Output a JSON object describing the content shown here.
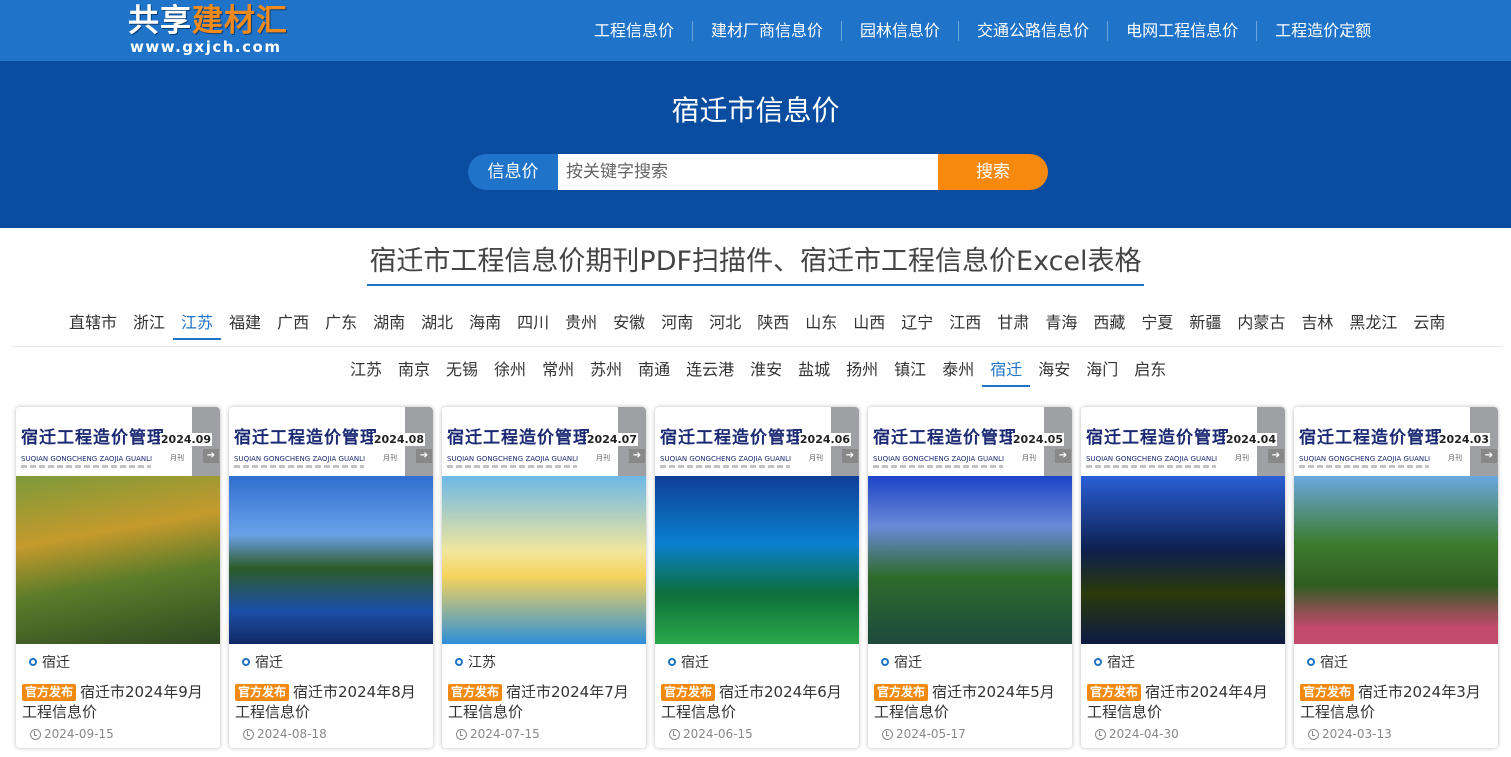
{
  "logo": {
    "title_part1": "共享",
    "title_part2": "建材汇",
    "url": "www.gxjch.com"
  },
  "nav": [
    "工程信息价",
    "建材厂商信息价",
    "园林信息价",
    "交通公路信息价",
    "电网工程信息价",
    "工程造价定额"
  ],
  "hero": {
    "title": "宿迁市信息价",
    "search_type": "信息价",
    "search_placeholder": "按关键字搜索",
    "search_button": "搜索"
  },
  "section_title": "宿迁市工程信息价期刊PDF扫描件、宿迁市工程信息价Excel表格",
  "provinces": [
    "直辖市",
    "浙江",
    "江苏",
    "福建",
    "广西",
    "广东",
    "湖南",
    "湖北",
    "海南",
    "四川",
    "贵州",
    "安徽",
    "河南",
    "河北",
    "陕西",
    "山东",
    "山西",
    "辽宁",
    "江西",
    "甘肃",
    "青海",
    "西藏",
    "宁夏",
    "新疆",
    "内蒙古",
    "吉林",
    "黑龙江",
    "云南"
  ],
  "active_province": "江苏",
  "cities": [
    "江苏",
    "南京",
    "无锡",
    "徐州",
    "常州",
    "苏州",
    "南通",
    "连云港",
    "淮安",
    "盐城",
    "扬州",
    "镇江",
    "泰州",
    "宿迁",
    "海安",
    "海门",
    "启东"
  ],
  "active_city": "宿迁",
  "badge_label": "官方发布",
  "magazine_title": "宿迁工程造价管理",
  "magazine_subtitle": "SUQIAN GONGCHENG ZAOJIA GUANLI",
  "magazine_freq": "月刊",
  "cards": [
    {
      "tag": "宿迁",
      "issue": "2024.09",
      "title": "宿迁市2024年9月工程信息价",
      "date": "2024-09-15"
    },
    {
      "tag": "宿迁",
      "issue": "2024.08",
      "title": "宿迁市2024年8月工程信息价",
      "date": "2024-08-18"
    },
    {
      "tag": "江苏",
      "issue": "2024.07",
      "title": "宿迁市2024年7月工程信息价",
      "date": "2024-07-15"
    },
    {
      "tag": "宿迁",
      "issue": "2024.06",
      "title": "宿迁市2024年6月工程信息价",
      "date": "2024-06-15"
    },
    {
      "tag": "宿迁",
      "issue": "2024.05",
      "title": "宿迁市2024年5月工程信息价",
      "date": "2024-05-17"
    },
    {
      "tag": "宿迁",
      "issue": "2024.04",
      "title": "宿迁市2024年4月工程信息价",
      "date": "2024-04-30"
    },
    {
      "tag": "宿迁",
      "issue": "2024.03",
      "title": "宿迁市2024年3月工程信息价",
      "date": "2024-03-13"
    }
  ],
  "colors": {
    "nav_bg": "#1f73c9",
    "hero_bg": "#0a4da0",
    "accent_orange": "#f7890f",
    "active_blue": "#1f73c9"
  }
}
